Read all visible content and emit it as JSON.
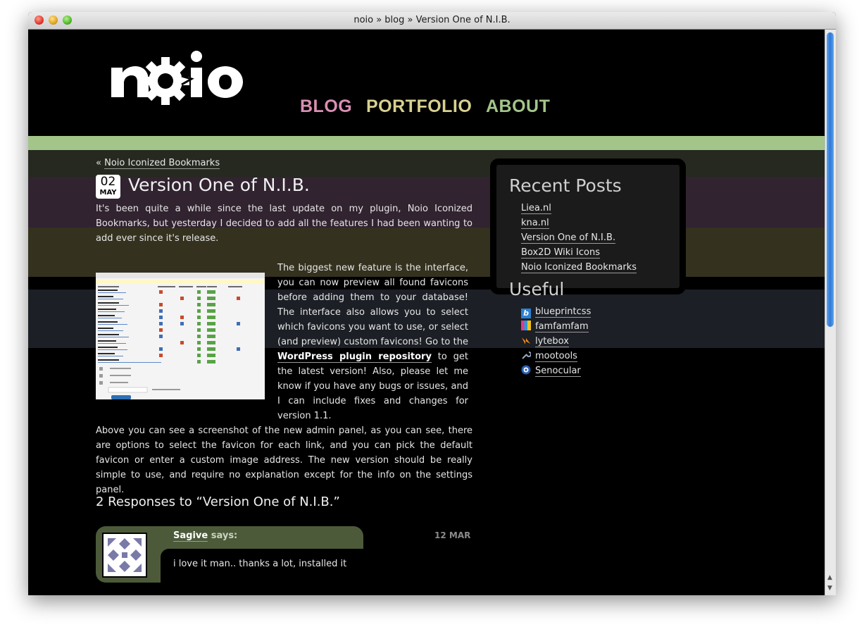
{
  "window": {
    "title": "noio » blog » Version One of N.I.B."
  },
  "nav": {
    "items": [
      {
        "label": "BLOG",
        "color": "#d98fb4"
      },
      {
        "label": "PORTFOLIO",
        "color": "#d8d18f"
      },
      {
        "label": "ABOUT",
        "color": "#a3c58a"
      }
    ]
  },
  "post": {
    "prev_prefix": "«",
    "prev_link": "Noio Iconized Bookmarks",
    "date_day": "02",
    "date_month": "MAY",
    "title": "Version One of N.I.B.",
    "intro": "It's been quite a while since the last update on my plugin, Noio Iconized Bookmarks, but yesterday I decided to add all the features I had been wanting to add ever since it's release.",
    "feature_text_1": "The biggest new feature is the interface, you can now preview all found favicons before adding them to your database! The interface also allows you to select which favicons you want to use, or select (and preview) custom favicons! Go to the",
    "feature_link": "WordPress plugin repository",
    "feature_text_2": "to get the latest version! Also, please let me know if you have any bugs or issues, and I can include fixes and changes for version 1.1.",
    "admin_text": "Above you can see a screenshot of the new admin panel, as you can see, there are options to select the favicon for each link, and you can pick the default favicon or enter a custom image address. The new version should be really simple to use, and require no explanation except for the info on the settings panel.",
    "responses_heading": "2 Responses to “Version One of N.I.B.”"
  },
  "comment": {
    "author": "Sagive",
    "says": "says:",
    "date": "12 MAR",
    "text": "i love it man.. thanks a lot, installed it"
  },
  "sidebar": {
    "recent_heading": "Recent Posts",
    "recent_posts": [
      "Liea.nl",
      "kna.nl",
      "Version One of N.I.B.",
      "Box2D Wiki Icons",
      "Noio Iconized Bookmarks"
    ],
    "useful_heading": "Useful",
    "useful_links": [
      {
        "label": "blueprintcss",
        "icon": "blueprint-icon"
      },
      {
        "label": "famfamfam",
        "icon": "famfamfam-icon"
      },
      {
        "label": "lytebox",
        "icon": "lytebox-icon"
      },
      {
        "label": "mootools",
        "icon": "wrench-icon"
      },
      {
        "label": "Senocular",
        "icon": "senocular-icon"
      }
    ]
  }
}
